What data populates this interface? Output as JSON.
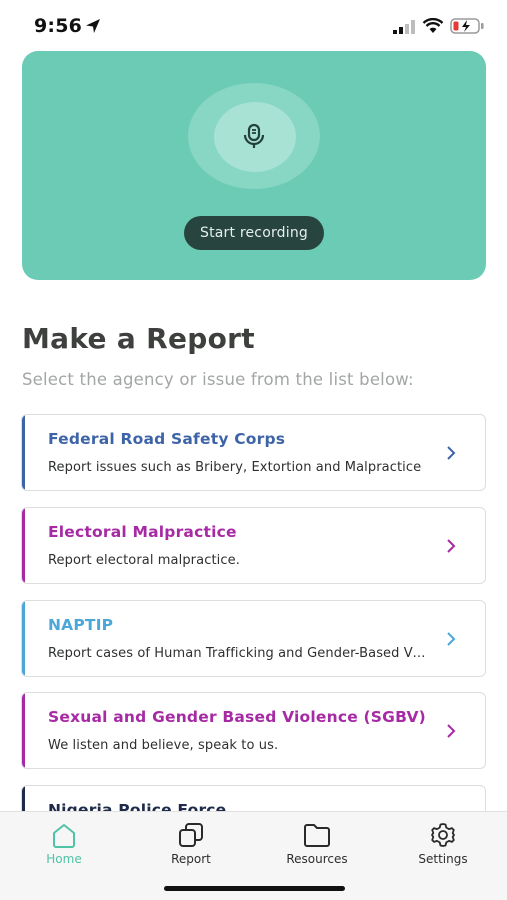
{
  "status_bar": {
    "time": "9:56"
  },
  "recorder": {
    "button_label": "Start recording",
    "card_color": "#6ccbb5"
  },
  "page": {
    "title": "Make a Report",
    "subtitle": "Select the agency or issue from the list below:"
  },
  "agencies": [
    {
      "title": "Federal Road Safety Corps",
      "description": "Report issues such as Bribery, Extortion and Malpractice",
      "color": "#3e64a8"
    },
    {
      "title": "Electoral Malpractice",
      "description": " Report electoral malpractice.",
      "color": "#a72aa5"
    },
    {
      "title": "NAPTIP",
      "description": "Report cases of Human Trafficking and Gender-Based Violence",
      "color": "#4aa7d8"
    },
    {
      "title": "Sexual and Gender Based Violence (SGBV)",
      "description": "We listen and believe, speak to us.",
      "color": "#a72aa5"
    },
    {
      "title": "Nigeria Police Force",
      "description": "",
      "color": "#1d2a4a"
    }
  ],
  "tabs": [
    {
      "label": "Home",
      "icon": "home-icon",
      "active": true
    },
    {
      "label": "Report",
      "icon": "report-icon",
      "active": false
    },
    {
      "label": "Resources",
      "icon": "folder-icon",
      "active": false
    },
    {
      "label": "Settings",
      "icon": "gear-icon",
      "active": false
    }
  ],
  "colors": {
    "accent": "#4fc3a6",
    "button_dark": "#27453e"
  }
}
